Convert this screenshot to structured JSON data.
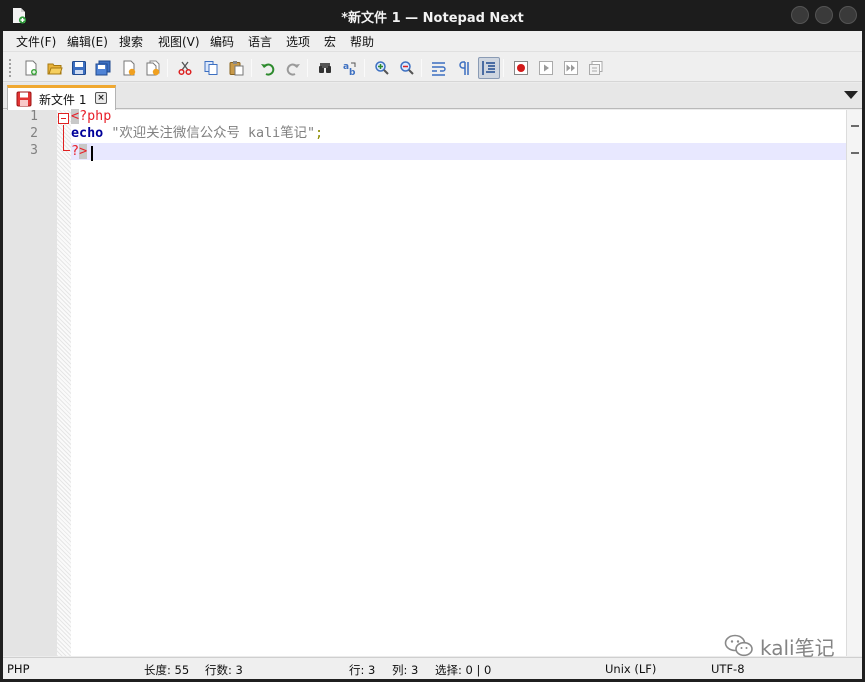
{
  "window": {
    "title": "*新文件 1 — Notepad Next"
  },
  "menu": {
    "items": [
      "文件(F)",
      "编辑(E)",
      "搜索",
      "视图(V)",
      "编码",
      "语言",
      "选项",
      "宏",
      "帮助"
    ]
  },
  "toolbar": {
    "icons": [
      "new-file-icon",
      "open-folder-icon",
      "save-icon",
      "save-all-icon",
      "close-icon",
      "close-all-icon",
      "cut-icon",
      "copy-icon",
      "paste-icon",
      "undo-icon",
      "redo-icon",
      "find-icon",
      "replace-icon",
      "zoom-in-icon",
      "zoom-out-icon",
      "word-wrap-icon",
      "show-all-chars-icon",
      "indent-guide-icon",
      "record-macro-icon",
      "play-macro-icon",
      "run-macro-multiple-icon",
      "save-macro-icon"
    ],
    "active": "indent-guide-icon"
  },
  "tabs": [
    {
      "label": "新文件 1",
      "modified": true
    }
  ],
  "editor": {
    "line_numbers": [
      "1",
      "2",
      "3"
    ],
    "lines": {
      "l1_tag": "<?php",
      "l2_kw": "echo",
      "l2_str": "\"欢迎关注微信公众号 kali笔记\"",
      "l2_punct": ";",
      "l3_tag": "?>"
    }
  },
  "status": {
    "language": "PHP",
    "length": "长度: 55",
    "lines": "行数: 3",
    "line": "行: 3",
    "column": "列: 3",
    "selection": "选择: 0 | 0",
    "eol": "Unix (LF)",
    "encoding": "UTF-8"
  },
  "watermark": {
    "text": "kali笔记"
  },
  "colors": {
    "php_tag": "#e8202a",
    "keyword": "#00009a",
    "string": "#808080",
    "caret_line": "#e8e8ff",
    "tab_accent": "#f0a830"
  }
}
